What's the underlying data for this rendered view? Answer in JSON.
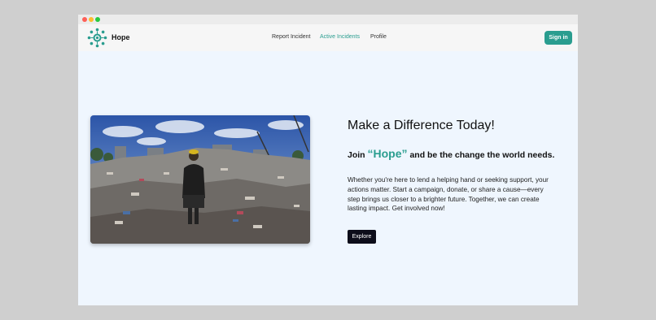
{
  "app": {
    "brand": "Hope"
  },
  "nav": {
    "links": [
      {
        "label": "Report Incident"
      },
      {
        "label": "Active Incidents"
      },
      {
        "label": "Profile"
      }
    ],
    "signin_label": "Sign in"
  },
  "hero": {
    "headline": "Make a Difference Today!",
    "sub_prefix": "Join",
    "sub_highlight": "“Hope”",
    "sub_suffix": "and be the change the world needs.",
    "body": "Whether you're here to lend a helping hand or seeking support, your actions matter. Start a campaign, donate, or share a cause—every step brings us closer to a brighter future. Together, we can create lasting impact. Get involved now!",
    "cta_label": "Explore"
  },
  "colors": {
    "accent": "#2a9d8f",
    "page_bg": "#eff6fe",
    "cta_bg": "#0d0d1a"
  },
  "icons": {
    "logo": "sun-logo-icon"
  }
}
